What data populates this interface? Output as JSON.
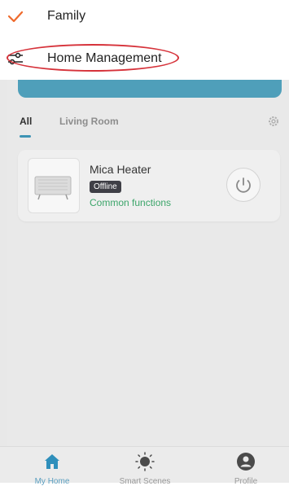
{
  "menu": {
    "items": [
      {
        "label": "Family",
        "icon": "checkmark-icon"
      },
      {
        "label": "Home Management",
        "icon": "sliders-icon"
      }
    ],
    "highlight_color": "#d6323a"
  },
  "home": {
    "tabs": [
      {
        "label": "All"
      },
      {
        "label": "Living Room"
      }
    ],
    "device": {
      "name": "Mica Heater",
      "status": "Offline",
      "functions_link": "Common functions"
    }
  },
  "tabbar": {
    "items": [
      {
        "label": "My Home"
      },
      {
        "label": "Smart Scenes"
      },
      {
        "label": "Profile"
      }
    ]
  },
  "colors": {
    "accent": "#3d93b4",
    "check": "#ef6a2c",
    "link_green": "#3ca56a"
  }
}
